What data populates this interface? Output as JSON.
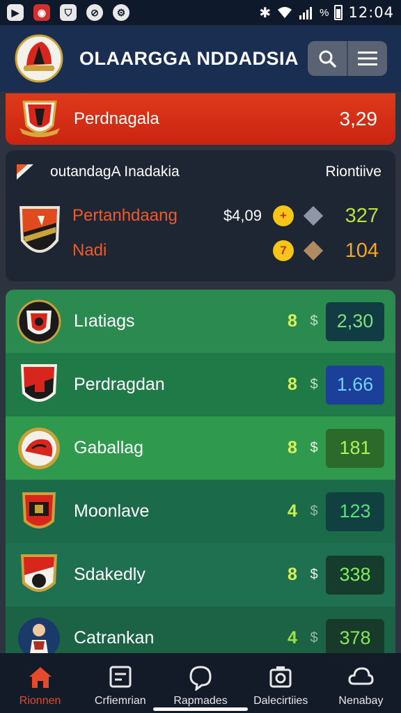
{
  "status_bar": {
    "time": "12:04",
    "signal_text": "%",
    "icons": [
      "play-icon",
      "camera-icon",
      "shield-icon",
      "no-image-icon",
      "vpn-icon",
      "bluetooth-icon",
      "wifi-icon",
      "signal-icon",
      "battery-icon"
    ]
  },
  "app": {
    "title": "OLAARGGA NDDADSIA",
    "actions": [
      "search-icon",
      "menu-icon"
    ],
    "colors": {
      "header": "#1a2e52",
      "accent_red": "#e03a1c",
      "active_nav": "#e54a2a"
    }
  },
  "banner": {
    "title": "Perdnagala",
    "value": "3,29"
  },
  "featured": {
    "title": "outandagA Inadakia",
    "tag": "Riontiive",
    "rows": [
      {
        "name": "Pertanhdaang",
        "price": "$4,09",
        "coin": "+",
        "value": "327",
        "value_color": "#b6e23a",
        "diamond_color": "#8e97a8"
      },
      {
        "name": "Nadi",
        "price": "",
        "coin": "7",
        "value": "104",
        "value_color": "#f5a623",
        "diamond_color": "#b08a60"
      }
    ]
  },
  "teams": [
    {
      "name": "Lıatiags",
      "badge": "8",
      "dollar": "$",
      "score": "2,30",
      "score_bg": "#123c44",
      "score_color": "#7fe07a",
      "row_bg": "#2a8a50"
    },
    {
      "name": "Perdragdan",
      "badge": "8",
      "dollar": "$",
      "score": "1.66",
      "score_bg": "#1c3f9a",
      "score_color": "#6fd2ff",
      "row_bg": "#1f7a47"
    },
    {
      "name": "Gaballag",
      "badge": "8",
      "dollar": "$",
      "score": "181",
      "score_bg": "#2c6a2c",
      "score_color": "#aef25a",
      "row_bg": "#2f9a4e"
    },
    {
      "name": "Moonlave",
      "badge": "4",
      "dollar": "$",
      "score": "123",
      "score_bg": "#114040",
      "score_color": "#58e07a",
      "row_bg": "#1b6a4a"
    },
    {
      "name": "Sdakedly",
      "badge": "8",
      "dollar": "$",
      "score": "338",
      "score_bg": "#163c2e",
      "score_color": "#7fee5a",
      "row_bg": "#1f7050"
    },
    {
      "name": "Catrankan",
      "badge": "4",
      "dollar": "$",
      "score": "378",
      "score_bg": "#173a2a",
      "score_color": "#88e85a",
      "row_bg": "#1c6346"
    }
  ],
  "bottom_nav": [
    {
      "label": "Rionnen",
      "icon": "home-icon",
      "active": true
    },
    {
      "label": "Crfiemrian",
      "icon": "calendar-icon",
      "active": false
    },
    {
      "label": "Rapmades",
      "icon": "chat-icon",
      "active": false
    },
    {
      "label": "Dalecirtiies",
      "icon": "camera-icon",
      "active": false
    },
    {
      "label": "Nenabay",
      "icon": "cloud-icon",
      "active": false
    }
  ]
}
